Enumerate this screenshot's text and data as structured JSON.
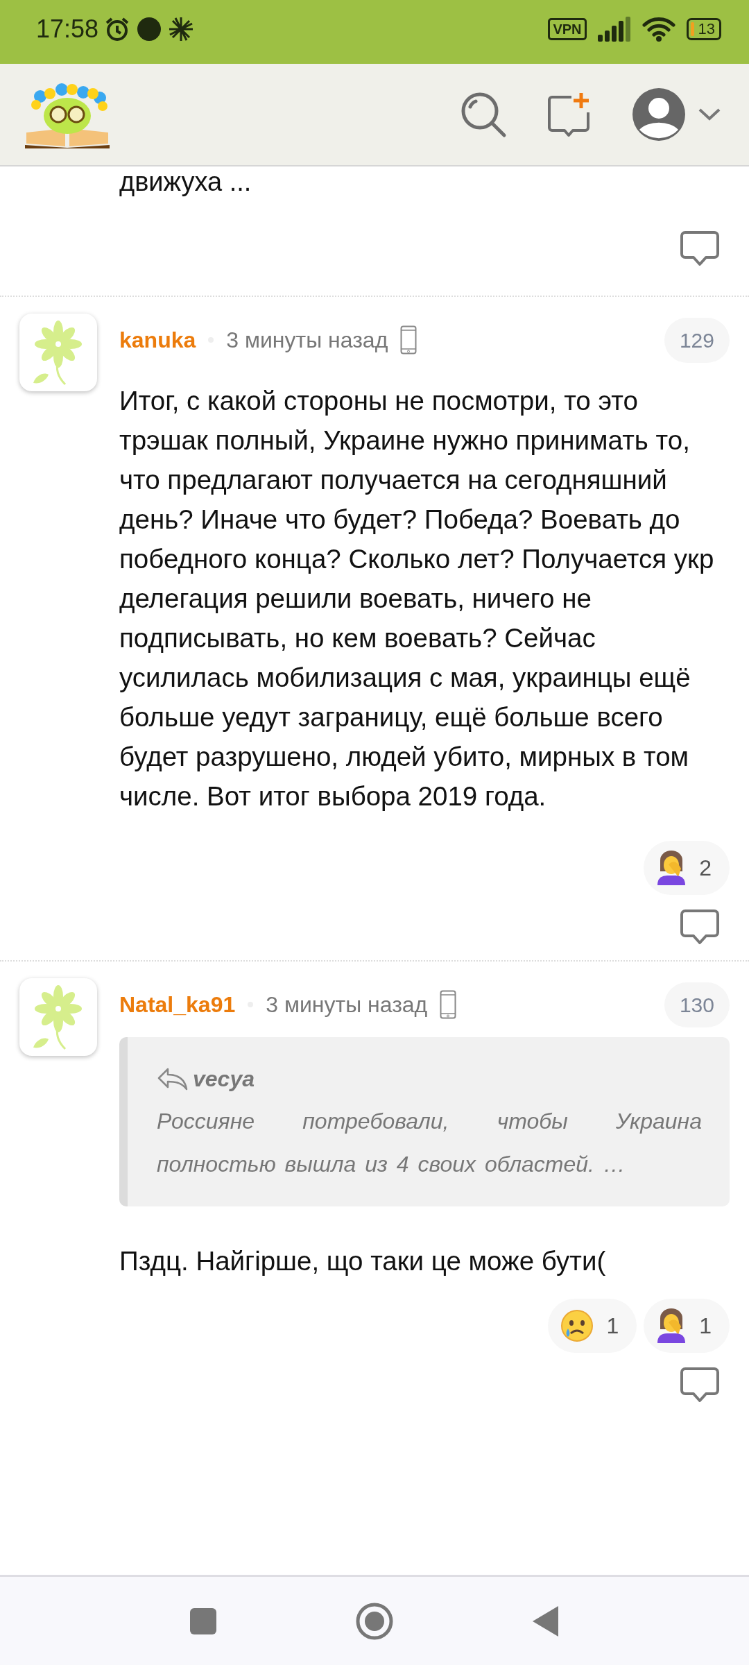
{
  "status_bar": {
    "time": "17:58",
    "vpn": "VPN",
    "battery": "13"
  },
  "previous_comment": {
    "text": "движуха ..."
  },
  "comments": [
    {
      "author": "kanuka",
      "time": "3 минуты назад",
      "number": "129",
      "text": "Итог, с какой стороны не посмотри, то это трэшак полный, Украине нужно принимать то, что предлагают получается на сегодняшний день? Иначе что будет? Победа? Воевать до победного конца? Сколько лет? Получается укр делегация решили воевать, ничего не подписывать, но кем воевать? Сейчас усилилась мобилизация с мая, украинцы ещё больше уедут заграницу, ещё больше всего будет разрушено, людей убито, мирных в том числе. Вот итог выбора 2019 года.",
      "reactions": [
        {
          "kind": "facepalm",
          "count": "2"
        }
      ]
    },
    {
      "author": "Natal_ka91",
      "time": "3 минуты назад",
      "number": "130",
      "quote": {
        "author": "vecya",
        "text": "Россияне потребовали, чтобы Украина полностью вышла из 4 своих областей. …"
      },
      "text": "Пздц. Найгірше, що таки це може бути(",
      "reactions": [
        {
          "kind": "crying",
          "count": "1"
        },
        {
          "kind": "facepalm",
          "count": "1"
        }
      ]
    }
  ]
}
